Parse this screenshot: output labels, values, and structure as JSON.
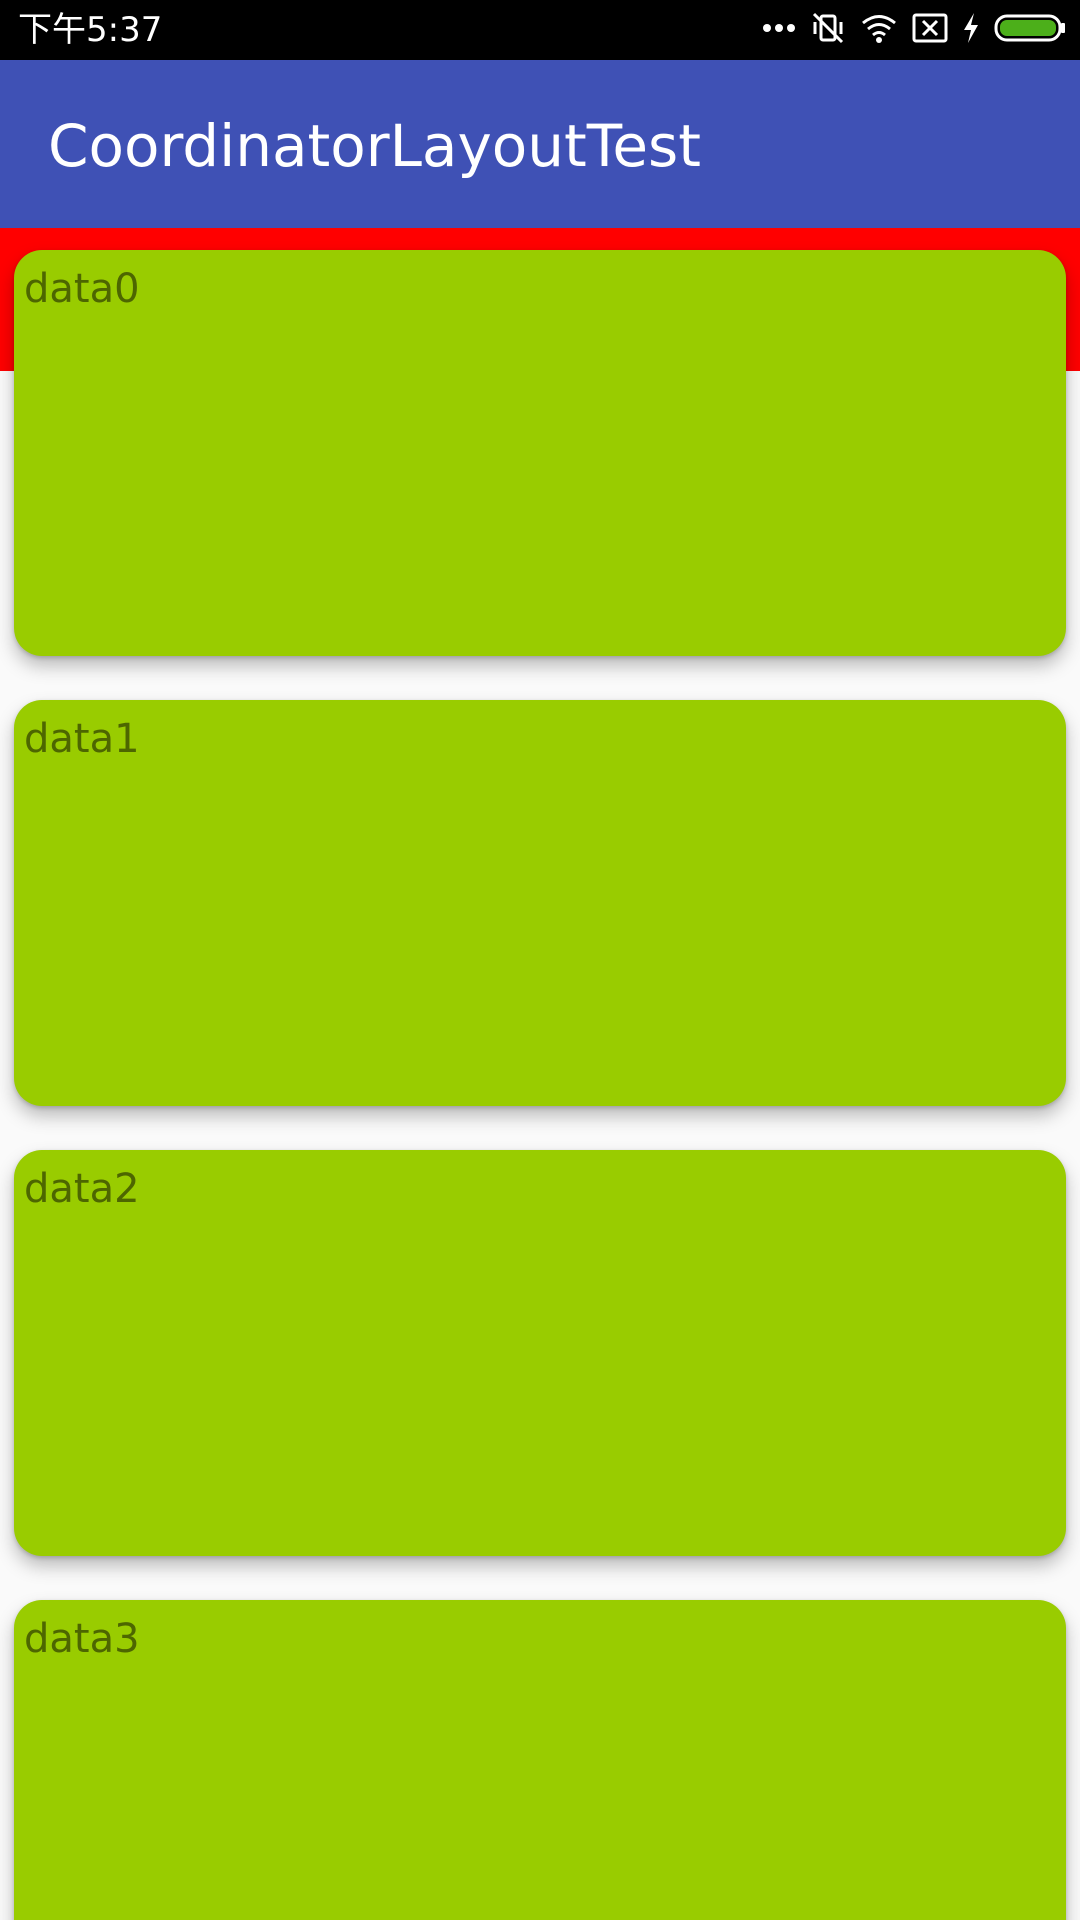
{
  "status_bar": {
    "time": "下午5:37",
    "icons": [
      "more-dots-icon",
      "vibrate-silent-icon",
      "wifi-icon",
      "sim-missing-icon",
      "charging-bolt-icon",
      "battery-full-icon"
    ],
    "battery_color": "#4caf1a"
  },
  "app_bar": {
    "title": "CoordinatorLayoutTest",
    "color": "#3f51b5"
  },
  "header": {
    "color": "#ff0000"
  },
  "cards": [
    {
      "label": "data0"
    },
    {
      "label": "data1"
    },
    {
      "label": "data2"
    },
    {
      "label": "data3"
    }
  ],
  "card_color": "#99cc00"
}
